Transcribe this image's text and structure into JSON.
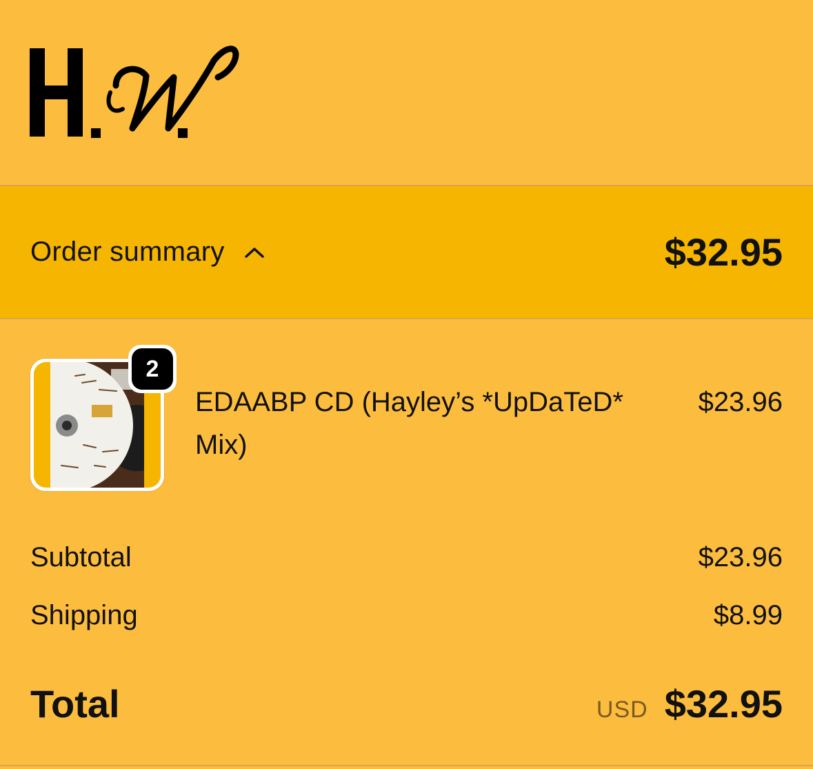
{
  "brand": {
    "logo_text": "H.W.",
    "logo_icon": "hw-monogram-logo"
  },
  "summary": {
    "label": "Order summary",
    "toggle_icon": "chevron-up-icon",
    "total": "$32.95"
  },
  "items": [
    {
      "name": "EDAABP CD (Hayley’s *UpDaTeD* Mix)",
      "quantity": "2",
      "price": "$23.96",
      "thumbnail_icon": "cd-product-photo"
    }
  ],
  "totals": {
    "subtotal_label": "Subtotal",
    "subtotal_value": "$23.96",
    "shipping_label": "Shipping",
    "shipping_value": "$8.99",
    "total_label": "Total",
    "currency": "USD",
    "total_value": "$32.95"
  },
  "colors": {
    "background": "#fcbc3e",
    "summary_bar": "#f6b500",
    "text": "#111111",
    "badge": "#000000"
  }
}
